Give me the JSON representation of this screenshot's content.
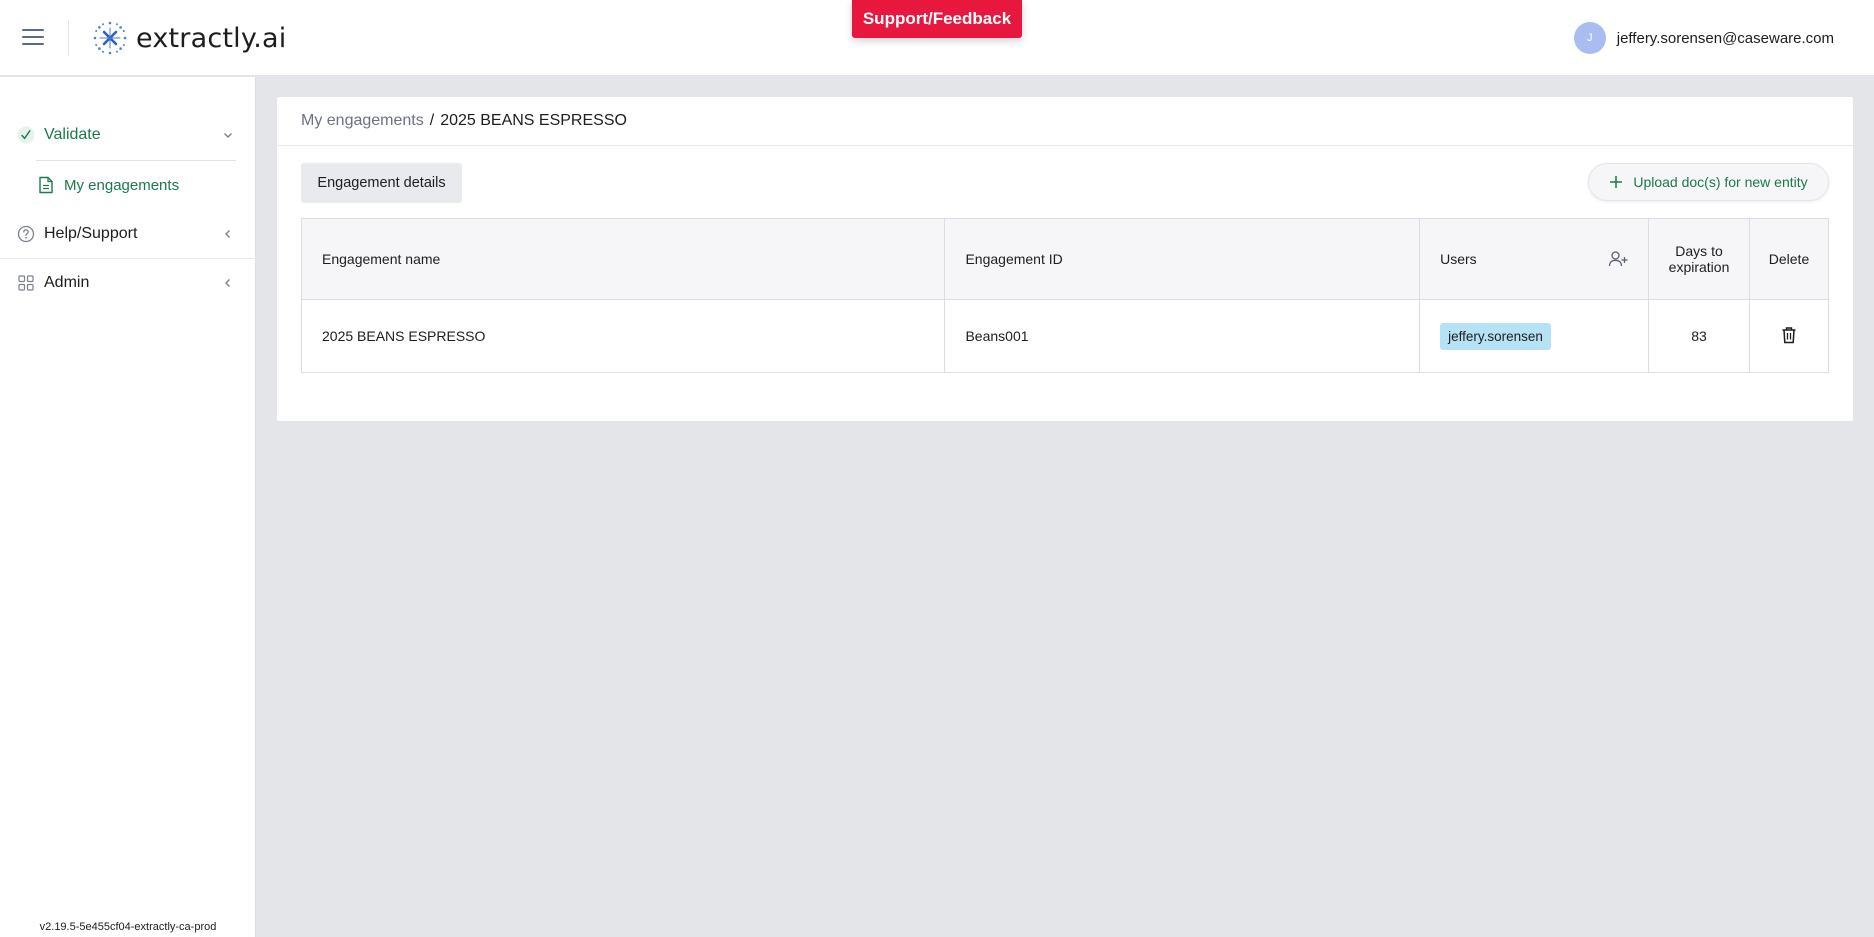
{
  "header": {
    "logo_text": "extractly.ai",
    "support_label": "Support/Feedback",
    "user_initial": "J",
    "user_email": "jeffery.sorensen@caseware.com"
  },
  "sidebar": {
    "items": [
      {
        "label": "Validate",
        "icon": "check-icon",
        "chevron": "chevron-down-icon",
        "active": true
      },
      {
        "label": "My engagements",
        "icon": "document-icon",
        "active": true
      },
      {
        "label": "Help/Support",
        "icon": "question-circle-icon",
        "chevron": "chevron-left-icon"
      },
      {
        "label": "Admin",
        "icon": "grid-icon",
        "chevron": "chevron-left-icon"
      }
    ],
    "version": "v2.19.5-5e455cf04-extractly-ca-prod"
  },
  "main": {
    "breadcrumb": {
      "parent": "My engagements",
      "separator": "/",
      "current": "2025 BEANS ESPRESSO"
    },
    "tab_label": "Engagement details",
    "upload_label": "Upload doc(s) for new entity",
    "table": {
      "headers": {
        "name": "Engagement name",
        "id": "Engagement ID",
        "users": "Users",
        "days_line1": "Days to",
        "days_line2": "expiration",
        "delete": "Delete"
      },
      "rows": [
        {
          "name": "2025 BEANS ESPRESSO",
          "id": "Beans001",
          "user": "jeffery.sorensen",
          "days": "83"
        }
      ]
    }
  },
  "colors": {
    "accent_green": "#1a7a4c",
    "support_red": "#e8173e",
    "user_chip": "#b5e3f5",
    "avatar": "#a9bdf0"
  }
}
